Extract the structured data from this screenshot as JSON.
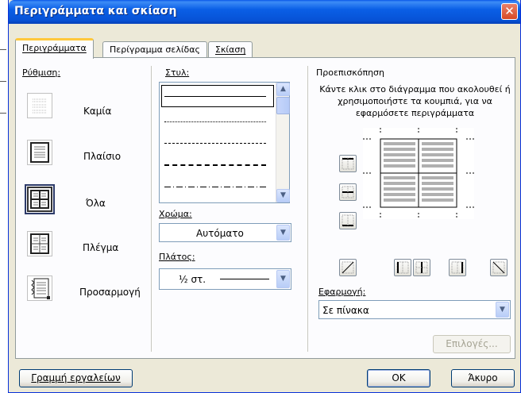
{
  "window": {
    "title": "Περιγράμματα και σκίαση",
    "close": "✕"
  },
  "tabs": [
    {
      "label": "Περιγράμματα"
    },
    {
      "label": "Περίγραμμα σελίδας"
    },
    {
      "label": "Σκίαση"
    }
  ],
  "setting": {
    "heading": "Ρύθμιση:",
    "options": [
      {
        "label": "Καμία"
      },
      {
        "label": "Πλαίσιο"
      },
      {
        "label": "Όλα"
      },
      {
        "label": "Πλέγμα"
      },
      {
        "label": "Προσαρμογή"
      }
    ],
    "selected": "Όλα"
  },
  "style": {
    "heading": "Στυλ:",
    "options": [
      "solid",
      "dotted",
      "dashed-short",
      "dashed",
      "dash-dot"
    ]
  },
  "color": {
    "heading": "Χρώμα:",
    "value": "Αυτόματο"
  },
  "width": {
    "heading": "Πλάτος:",
    "value": "½ στ."
  },
  "preview": {
    "heading": "Προεπισκόπηση",
    "instructions": "Κάντε κλικ στο διάγραμμα που ακολουθεί ή χρησιμοποιήστε τα κουμπιά, για να εφαρμόσετε περιγράμματα"
  },
  "apply_to": {
    "heading": "Εφαρμογή:",
    "value": "Σε πίνακα"
  },
  "buttons": {
    "options": "Επιλογές...",
    "toolbar": "Γραμμή εργαλείων",
    "ok": "OK",
    "cancel": "Άκυρο"
  },
  "colors": {
    "titlebar": "#0a5fe6",
    "dialog": "#ece9d8",
    "tab_highlight": "#ffc83c"
  }
}
